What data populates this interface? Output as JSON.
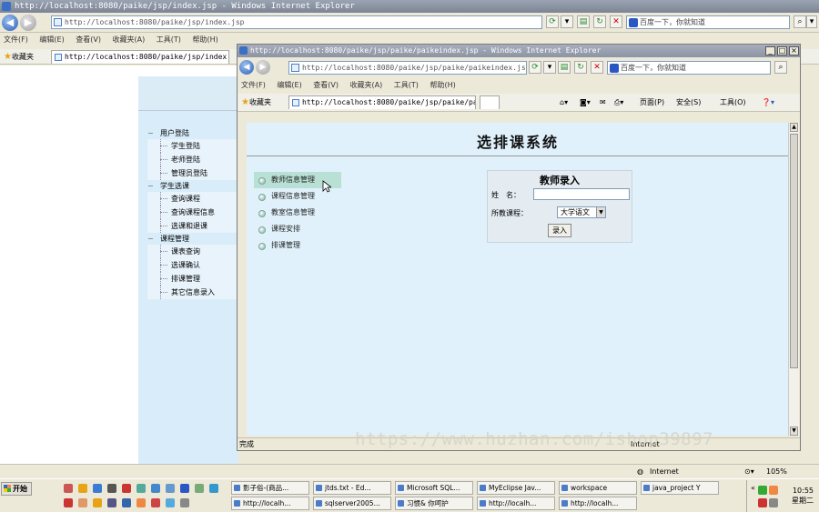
{
  "outer_window": {
    "title": "http://localhost:8080/paike/jsp/index.jsp - Windows Internet Explorer",
    "address": "http://localhost:8080/paike/jsp/index.jsp",
    "search_placeholder": "百度一下，你就知道",
    "menu": [
      "文件(F)",
      "编辑(E)",
      "查看(V)",
      "收藏夹(A)",
      "工具(T)",
      "帮助(H)"
    ],
    "favorites_label": "收藏夹",
    "tab_label": "http://localhost:8080/paike/jsp/index.jsp",
    "status_zone": "Internet",
    "zoom": "105%"
  },
  "outer_nav_tree": [
    {
      "group": "用户登陆",
      "items": [
        "学生登陆",
        "老师登陆",
        "管理员登陆"
      ]
    },
    {
      "group": "学生选课",
      "items": [
        "查询课程",
        "查询课程信息",
        "选课和退课"
      ]
    },
    {
      "group": "课程管理",
      "items": [
        "课表查询",
        "选课确认",
        "排课管理",
        "其它信息录入"
      ]
    }
  ],
  "inner_window": {
    "title": "http://localhost:8080/paike/jsp/paike/paikeindex.jsp - Windows Internet Explorer",
    "address": "http://localhost:8080/paike/jsp/paike/paikeindex.jsp",
    "search_placeholder": "百度一下，你就知道",
    "menu": [
      "文件(F)",
      "编辑(E)",
      "查看(V)",
      "收藏夹(A)",
      "工具(T)",
      "帮助(H)"
    ],
    "favorites_label": "收藏夹",
    "tab_label": "http://localhost:8080/paike/jsp/paike/pai...",
    "cmd_page": "页面(P)",
    "cmd_safety": "安全(S)",
    "cmd_tools": "工具(O)",
    "status_left": "完成",
    "status_zone": "Internet"
  },
  "page": {
    "system_title": "选排课系统",
    "left_menu": [
      "教师信息管理",
      "课程信息管理",
      "教室信息管理",
      "课程安排",
      "排课管理"
    ],
    "form": {
      "title": "教师录入",
      "name_label": "姓　名：",
      "name_value": "",
      "course_label": "所教课程：",
      "course_selected": "大学语文",
      "submit_label": "录入"
    }
  },
  "watermark": "https://www.huzhan.com/ishop39897",
  "taskbar": {
    "start_label": "开始",
    "buttons": [
      "影子俗-(商品...",
      "jtds.txt - Ed...",
      "Microsoft SQL...",
      "MyEclipse Jav...",
      "workspace",
      "java_project Y",
      "http://localh...",
      "sqlserver2005...",
      "习惯& 你呵护",
      "http://localh...",
      "http://localh..."
    ],
    "clock_time": "10:55",
    "clock_day": "星期二"
  }
}
